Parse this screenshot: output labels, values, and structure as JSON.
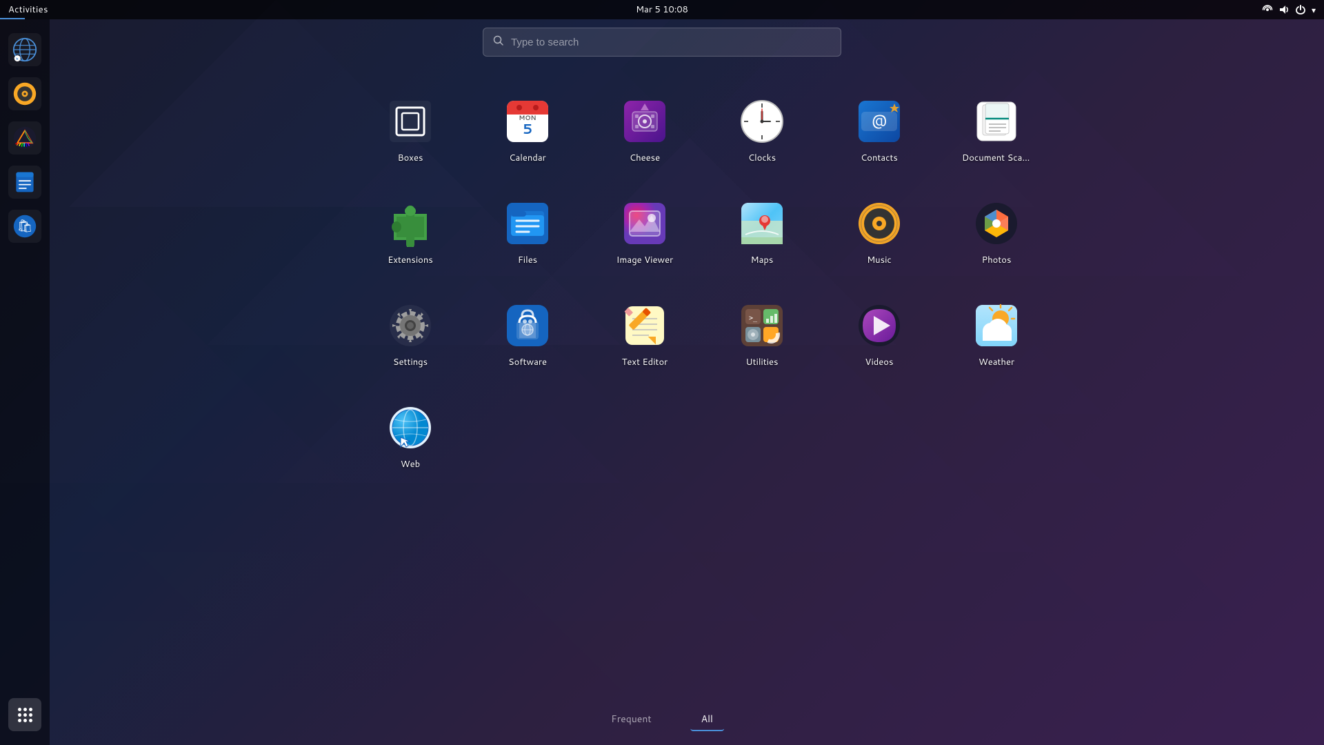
{
  "topbar": {
    "activities_label": "Activities",
    "clock": "Mar 5  10:08",
    "network_icon": "network-icon",
    "sound_icon": "sound-icon",
    "power_icon": "power-icon"
  },
  "search": {
    "placeholder": "Type to search"
  },
  "sidebar": {
    "items": [
      {
        "id": "web-browser",
        "label": "Web Browser"
      },
      {
        "id": "sound",
        "label": "Sound"
      },
      {
        "id": "prism",
        "label": "Prism"
      },
      {
        "id": "notes",
        "label": "Notes"
      },
      {
        "id": "software-store",
        "label": "Software"
      }
    ],
    "dots_label": "Show Apps"
  },
  "apps": [
    {
      "id": "boxes",
      "label": "Boxes",
      "color1": "#ffffff",
      "color2": "#cccccc"
    },
    {
      "id": "calendar",
      "label": "Calendar",
      "color1": "#1565c0",
      "color2": "#e53935"
    },
    {
      "id": "cheese",
      "label": "Cheese",
      "color1": "#7b2d8b",
      "color2": "#5a1a6b"
    },
    {
      "id": "clocks",
      "label": "Clocks",
      "color1": "#555555",
      "color2": "#333333"
    },
    {
      "id": "contacts",
      "label": "Contacts",
      "color1": "#1565c0",
      "color2": "#0d47a1"
    },
    {
      "id": "document-scanner",
      "label": "Document Scan...",
      "color1": "#00897b",
      "color2": "#ffffff"
    },
    {
      "id": "extensions",
      "label": "Extensions",
      "color1": "#43a047",
      "color2": "#2e7d32"
    },
    {
      "id": "files",
      "label": "Files",
      "color1": "#1565c0",
      "color2": "#0d47a1"
    },
    {
      "id": "image-viewer",
      "label": "Image Viewer",
      "color1": "#e91e63",
      "color2": "#9c27b0"
    },
    {
      "id": "maps",
      "label": "Maps",
      "color1": "#4fc3f7",
      "color2": "#e53935"
    },
    {
      "id": "music",
      "label": "Music",
      "color1": "#f9a825",
      "color2": "#333"
    },
    {
      "id": "photos",
      "label": "Photos",
      "color1": "#ff5722",
      "color2": "#ffc107"
    },
    {
      "id": "settings",
      "label": "Settings",
      "color1": "#757575",
      "color2": "#424242"
    },
    {
      "id": "software",
      "label": "Software",
      "color1": "#1565c0",
      "color2": "#0d47a1"
    },
    {
      "id": "text-editor",
      "label": "Text Editor",
      "color1": "#f9a825",
      "color2": "#fbc02d"
    },
    {
      "id": "utilities",
      "label": "Utilities",
      "color1": "#795548",
      "color2": "#4caf50"
    },
    {
      "id": "videos",
      "label": "Videos",
      "color1": "#ab47bc",
      "color2": "#7b1fa2"
    },
    {
      "id": "weather",
      "label": "Weather",
      "color1": "#f9a825",
      "color2": "#ffffff"
    },
    {
      "id": "web",
      "label": "Web",
      "color1": "#1565c0",
      "color2": "#4fc3f7"
    }
  ],
  "tabs": [
    {
      "id": "frequent",
      "label": "Frequent",
      "active": false
    },
    {
      "id": "all",
      "label": "All",
      "active": true
    }
  ]
}
